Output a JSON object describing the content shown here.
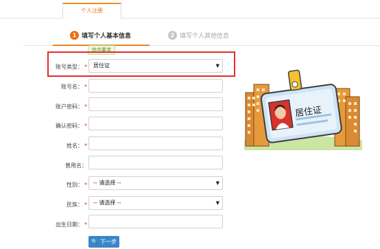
{
  "tab": {
    "label": "个人注册"
  },
  "steps": [
    {
      "num": "1",
      "label": "填写个人基本信息"
    },
    {
      "num": "2",
      "label": "填写个人其他信息"
    }
  ],
  "tooltip": "符合要求",
  "form": {
    "account_type": {
      "label": "账号类型：",
      "value": "居住证"
    },
    "account_name": {
      "label": "账号名：",
      "value": ""
    },
    "password": {
      "label": "账户密码：",
      "value": ""
    },
    "confirm_password": {
      "label": "确认密码：",
      "value": ""
    },
    "name": {
      "label": "姓名：",
      "value": ""
    },
    "former_name": {
      "label": "曾用名：",
      "value": ""
    },
    "gender": {
      "label": "性别：",
      "value": "-- 请选择 --"
    },
    "ethnicity": {
      "label": "民族：",
      "value": "-- 请选择 --"
    },
    "birth_date": {
      "label": "出生日期：",
      "value": ""
    }
  },
  "required_mark": "*",
  "next_button": "下一步",
  "illustration": {
    "card_text": "居住证"
  },
  "colors": {
    "accent_orange": "#ee6f14",
    "highlight_red": "#e32b2b",
    "button_blue": "#3a86c8"
  }
}
